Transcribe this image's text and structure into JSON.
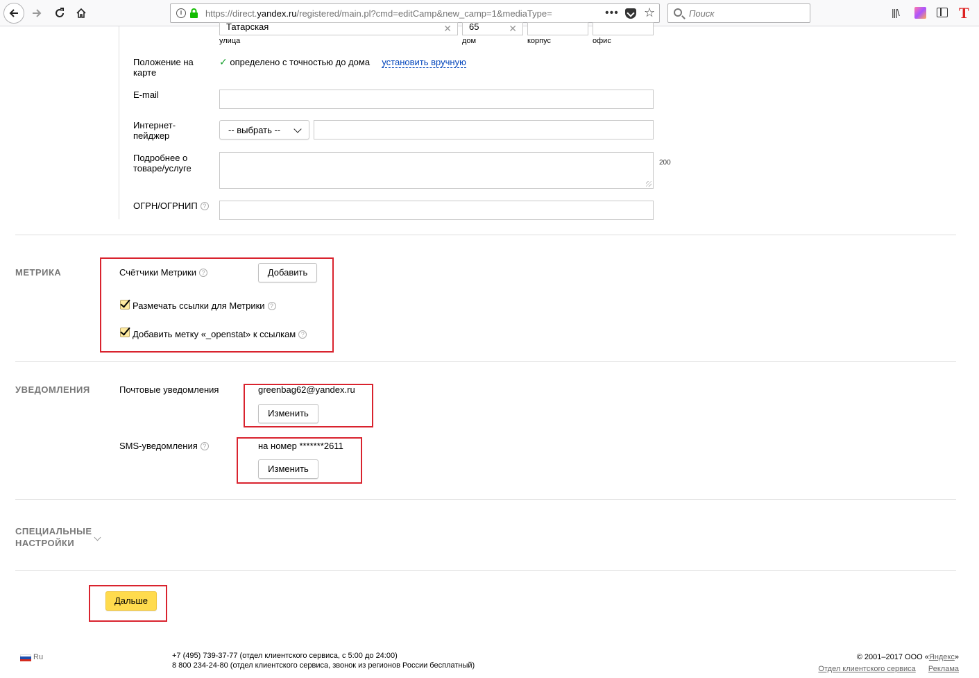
{
  "browser": {
    "url_prefix": "https://direct.",
    "url_domain": "yandex.ru",
    "url_rest": "/registered/main.pl?cmd=editCamp&new_camp=1&mediaType=",
    "url_more": "•••",
    "search_placeholder": "Поиск",
    "lib_glyph": "|||\\",
    "t_glyph": "T"
  },
  "address": {
    "street_value": "Татарская",
    "house_value": "65",
    "street_label": "улица",
    "house_label": "дом",
    "building_label": "корпус",
    "office_label": "офис"
  },
  "map_position": {
    "label": "Положение на карте",
    "status": "определено с точностью до дома",
    "set_manual": "установить вручную"
  },
  "email": {
    "label": "E-mail"
  },
  "pager": {
    "label": "Интернет-пейджер",
    "select_value": "-- выбрать --"
  },
  "details": {
    "label": "Подробнее о товаре/услуге",
    "counter": "200"
  },
  "ogrn": {
    "label": "ОГРН/ОГРНИП"
  },
  "metrika": {
    "title": "МЕТРИКА",
    "counters_label": "Счётчики Метрики",
    "add_button": "Добавить",
    "mark_links": "Размечать ссылки для Метрики",
    "openstat": "Добавить метку «_openstat» к ссылкам"
  },
  "notifications": {
    "title": "УВЕДОМЛЕНИЯ",
    "mail_label": "Почтовые уведомления",
    "mail_value": "greenbag62@yandex.ru",
    "change_button": "Изменить",
    "sms_label": "SMS-уведомления",
    "sms_value": "на номер *******2611",
    "sms_change_button": "Изменить"
  },
  "special": {
    "title": "СПЕЦИАЛЬНЫЕ НАСТРОЙКИ"
  },
  "next_button": "Дальше",
  "footer": {
    "lang": "Ru",
    "phone1": "+7 (495) 739-37-77 (отдел клиентского сервиса, с 5:00 до 24:00)",
    "phone2": "8 800 234-24-80 (отдел клиентского сервиса, звонок из регионов России бесплатный)",
    "copyright_prefix": "© 2001–2017 ООО «",
    "copyright_link": "Яндекс",
    "copyright_suffix": "»",
    "client_service": "Отдел клиентского сервиса",
    "ads": "Реклама"
  },
  "colors": {
    "highlight_box": "#d9232e",
    "primary_button": "#ffdb4d",
    "link": "#0044bb",
    "success_check": "#19a12f"
  }
}
